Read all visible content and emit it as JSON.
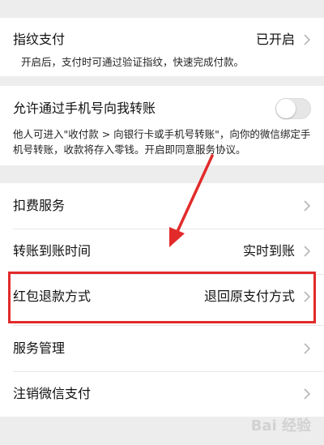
{
  "fingerprint_pay": {
    "title": "指纹支付",
    "value": "已开启",
    "description": "开启后，支付时可通过验证指纹，快速完成付款。"
  },
  "phone_transfer": {
    "title": "允许通过手机号向我转账",
    "enabled": false,
    "description": "他人可进入\"收付款 > 向银行卡或手机号转账\"，向你的微信绑定手机号转账，收款将存入零钱。开启即同意服务协议。"
  },
  "items": [
    {
      "title": "扣费服务",
      "value": ""
    },
    {
      "title": "转账到账时间",
      "value": "实时到账"
    },
    {
      "title": "红包退款方式",
      "value": "退回原支付方式"
    },
    {
      "title": "服务管理",
      "value": ""
    },
    {
      "title": "注销微信支付",
      "value": ""
    }
  ],
  "watermark": "Bai 经验",
  "colors": {
    "background": "#ededed",
    "card": "#ffffff",
    "annotation_red": "#e22a2a",
    "toggle_off": "#e6e6e6"
  },
  "icons": {
    "chevron": "chevron-right-icon"
  }
}
